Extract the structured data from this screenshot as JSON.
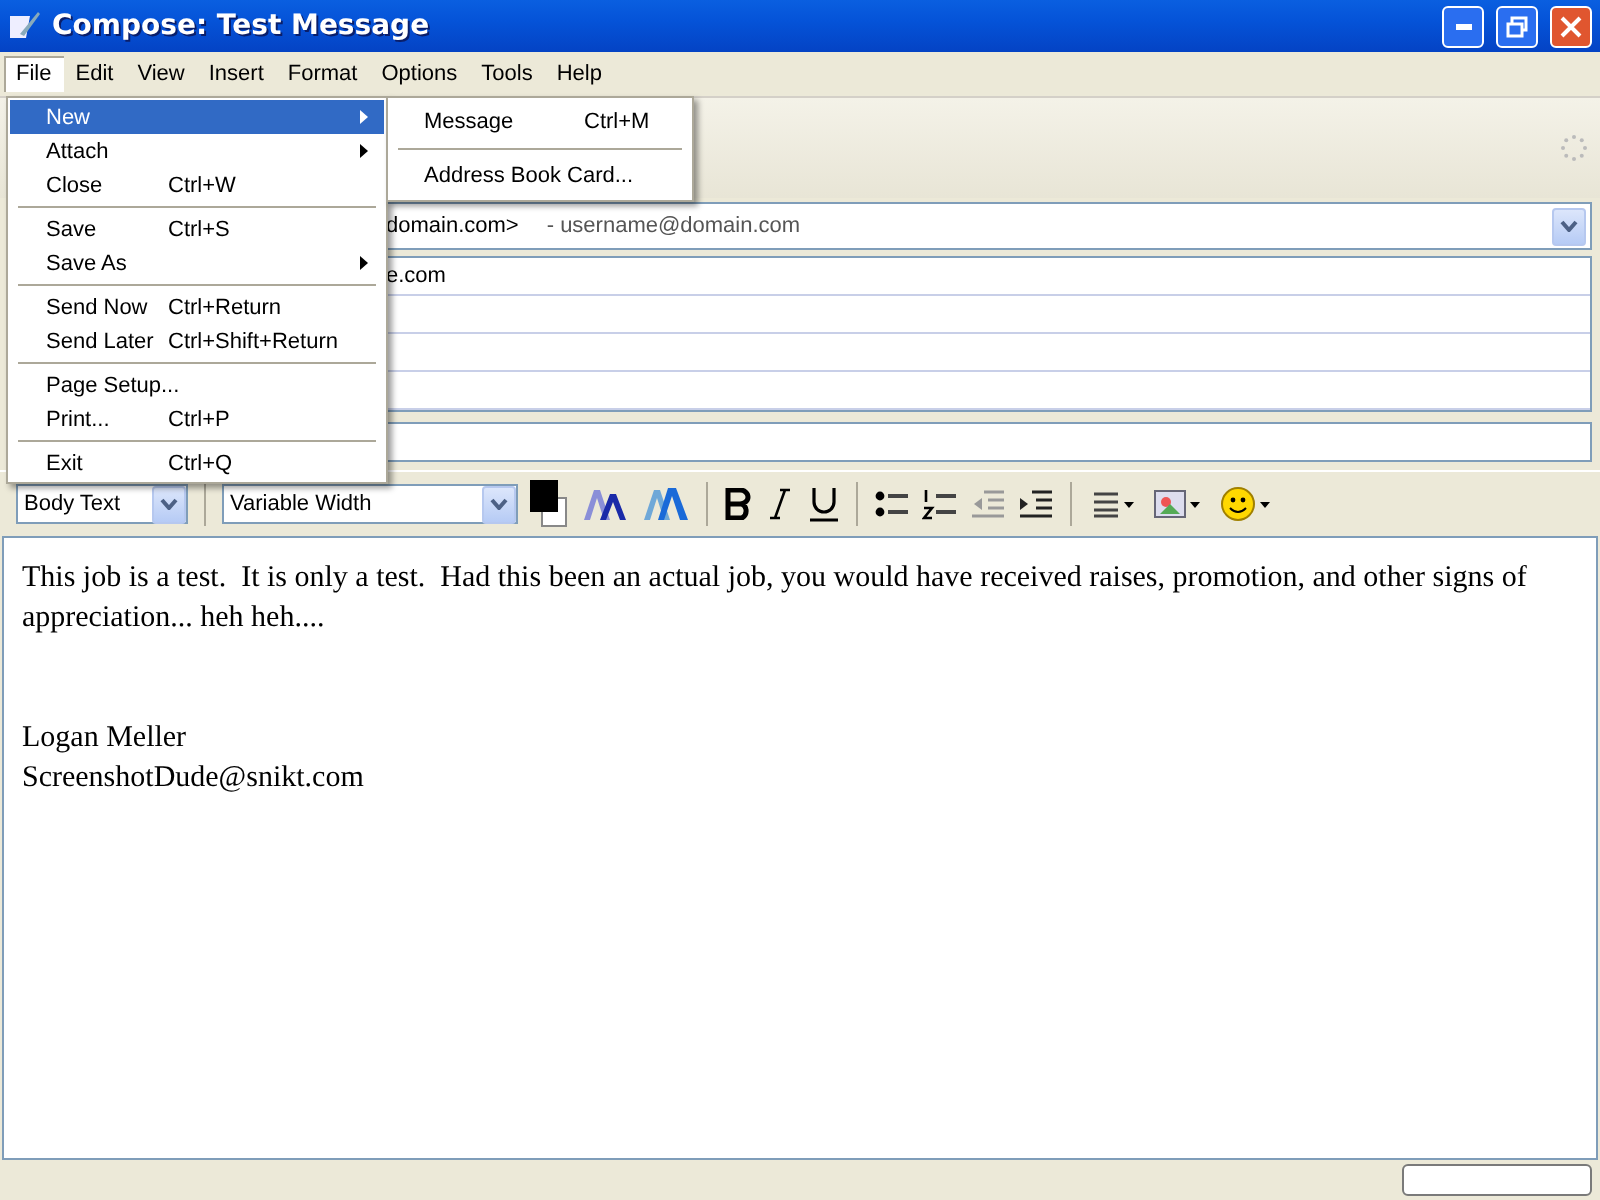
{
  "window": {
    "title": "Compose: Test Message"
  },
  "menubar": [
    {
      "label": "File",
      "selected": true
    },
    {
      "label": "Edit",
      "selected": false
    },
    {
      "label": "View",
      "selected": false
    },
    {
      "label": "Insert",
      "selected": false
    },
    {
      "label": "Format",
      "selected": false
    },
    {
      "label": "Options",
      "selected": false
    },
    {
      "label": "Tools",
      "selected": false
    },
    {
      "label": "Help",
      "selected": false
    }
  ],
  "file_menu": [
    {
      "kind": "item",
      "label": "New",
      "submenu": true,
      "selected": true
    },
    {
      "kind": "item",
      "label": "Attach",
      "submenu": true,
      "selected": false
    },
    {
      "kind": "item",
      "label": "Close",
      "shortcut": "Ctrl+W",
      "submenu": false,
      "selected": false
    },
    {
      "kind": "separator"
    },
    {
      "kind": "item",
      "label": "Save",
      "shortcut": "Ctrl+S",
      "submenu": false,
      "selected": false
    },
    {
      "kind": "item",
      "label": "Save As",
      "submenu": true,
      "selected": false
    },
    {
      "kind": "separator"
    },
    {
      "kind": "item",
      "label": "Send Now",
      "shortcut": "Ctrl+Return",
      "submenu": false,
      "selected": false
    },
    {
      "kind": "item",
      "label": "Send Later",
      "shortcut": "Ctrl+Shift+Return",
      "submenu": false,
      "selected": false
    },
    {
      "kind": "separator"
    },
    {
      "kind": "item",
      "label": "Page Setup...",
      "submenu": false,
      "selected": false
    },
    {
      "kind": "item",
      "label": "Print...",
      "shortcut": "Ctrl+P",
      "submenu": false,
      "selected": false
    },
    {
      "kind": "separator"
    },
    {
      "kind": "item",
      "label": "Exit",
      "shortcut": "Ctrl+Q",
      "submenu": false,
      "selected": false
    }
  ],
  "new_submenu": [
    {
      "kind": "item",
      "label": "Message",
      "shortcut": "Ctrl+M"
    },
    {
      "kind": "separator"
    },
    {
      "kind": "item",
      "label": "Address Book Card..."
    }
  ],
  "from": {
    "value": "domain.com>",
    "account": "- username@domain.com"
  },
  "recipients": [
    "e.com"
  ],
  "format_bar": {
    "paragraph": "Body Text",
    "font": "Variable Width"
  },
  "body": {
    "message": "This job is a test.  It is only a test.  Had this been an actual job, you would have received raises, promotion, and other signs of appreciation... heh heh....",
    "signature": [
      "Logan Meller",
      "ScreenshotDude@snikt.com"
    ]
  }
}
